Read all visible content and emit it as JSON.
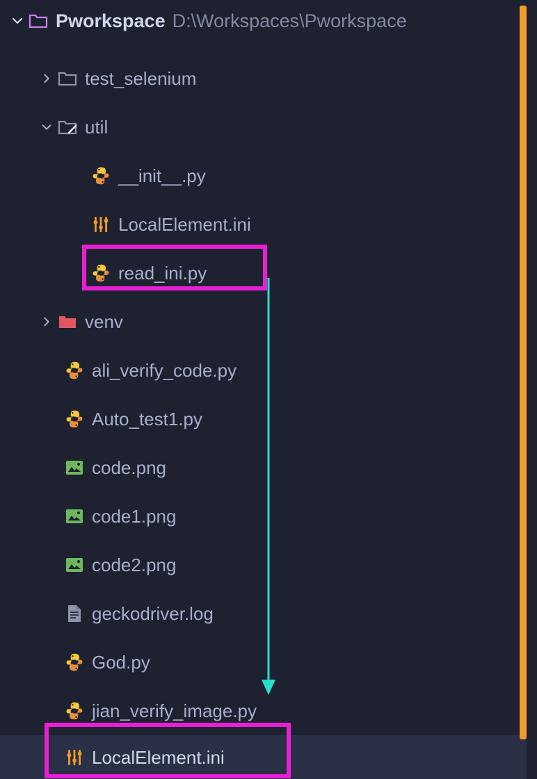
{
  "root": {
    "name": "Pworkspace",
    "path": "D:\\Workspaces\\Pworkspace"
  },
  "tree": {
    "test_selenium": "test_selenium",
    "util": "util",
    "util_children": {
      "init": "__init__.py",
      "localElement": "LocalElement.ini",
      "read_ini": "read_ini.py"
    },
    "venv": "venv",
    "files": {
      "ali_verify": "ali_verify_code.py",
      "auto_test1": "Auto_test1.py",
      "code_png": "code.png",
      "code1_png": "code1.png",
      "code2_png": "code2.png",
      "gecko": "geckodriver.log",
      "god": "God.py",
      "jian_verify": "jian_verify_image.py",
      "localElement2": "LocalElement.ini"
    }
  }
}
